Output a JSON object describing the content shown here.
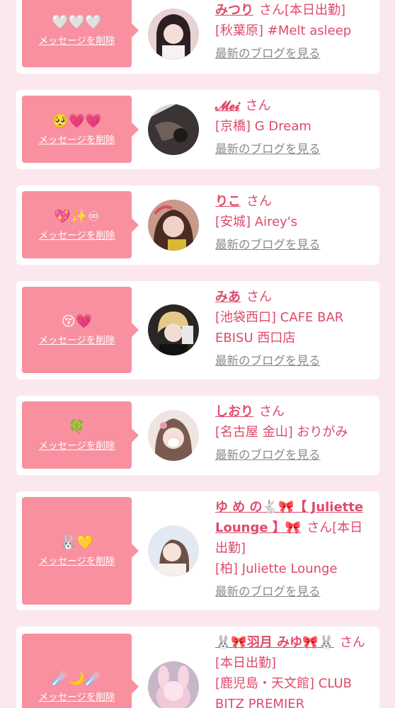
{
  "common": {
    "delete_label": "メッセージを削除",
    "san": "さん",
    "blog_link": "最新のブログを見る"
  },
  "favorites": [
    {
      "emoji": "🤍🤍🤍",
      "name": "みつり",
      "tag": "[本日出勤]",
      "shop": "[秋葉原] #Melt asleep"
    },
    {
      "emoji": "🥺💗💗",
      "name": "𝓜𝓮𝓲",
      "tag": "",
      "shop": "[京橋] G Dream"
    },
    {
      "emoji": "💖✨♾",
      "name": "りこ",
      "tag": "",
      "shop": "[安城] Airey's"
    },
    {
      "emoji": "😚💗",
      "name": "みあ",
      "tag": "",
      "shop": "[池袋西口] CAFE BAR EBISU 西口店"
    },
    {
      "emoji": "🍀",
      "name": "しおり",
      "tag": "",
      "shop": "[名古屋 金山] おりがみ"
    },
    {
      "emoji": "🐰💛",
      "name": "ゆ め の🐇🎀【 Juliette Lounge 】🎀",
      "tag": "[本日出勤]",
      "shop": "[柏] Juliette Lounge"
    },
    {
      "emoji": "☄️🌙☄️",
      "name": "🐰🎀羽月 みゆ🎀🐰",
      "tag": "[本日出勤]",
      "shop": "[鹿児島・天文館] CLUB BITZ PREMIER"
    }
  ]
}
